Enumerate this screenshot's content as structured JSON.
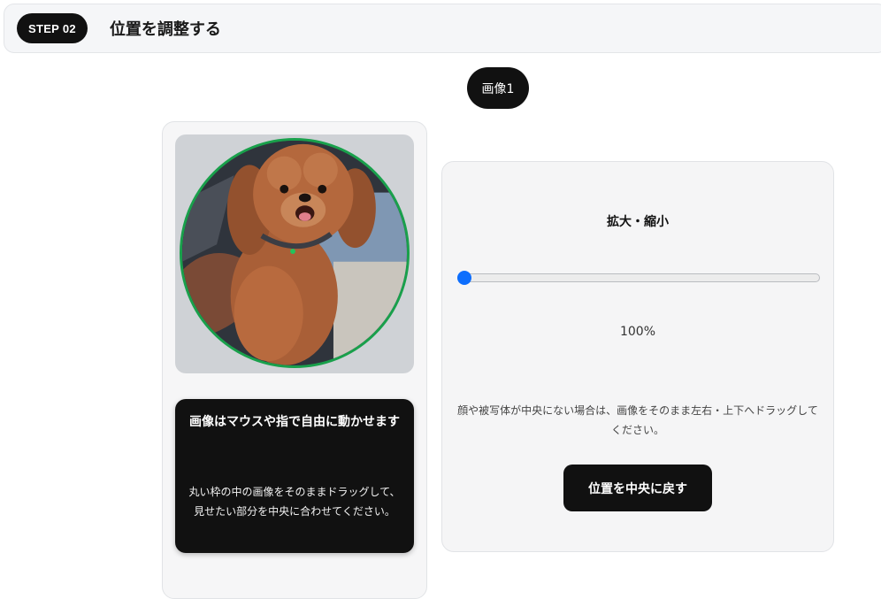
{
  "step": {
    "badge": "STEP 02",
    "title": "位置を調整する"
  },
  "image_tab": {
    "label": "画像1"
  },
  "preview": {
    "ring_color": "#19a04b",
    "image_subject": "dog-photo"
  },
  "hint": {
    "title": "画像はマウスや指で自由に動かせます",
    "body": "丸い枠の中の画像をそのままドラッグして、見せたい部分を中央に合わせてください。"
  },
  "zoom": {
    "title": "拡大・縮小",
    "slider_fraction": 0.0,
    "value_text": "100%",
    "accent_color": "#0d6efd"
  },
  "instructions": {
    "text": "顔や被写体が中央にない場合は、画像をそのまま左右・上下へドラッグしてください。"
  },
  "actions": {
    "center_label": "位置を中央に戻す"
  }
}
